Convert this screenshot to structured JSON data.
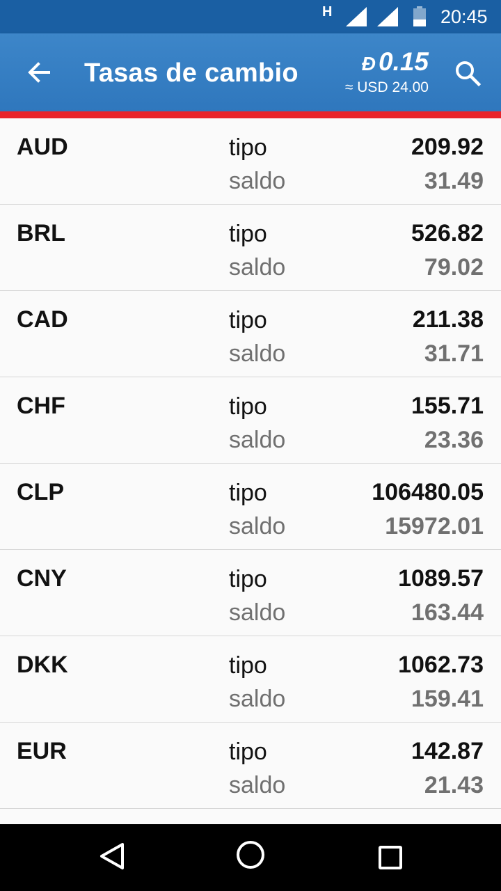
{
  "status_bar": {
    "network_type": "H",
    "time": "20:45",
    "icons": [
      "signal-icon",
      "signal-icon",
      "battery-icon"
    ]
  },
  "app_bar": {
    "title": "Tasas de cambio",
    "balance_symbol": "Đ",
    "balance_value": "0.15",
    "balance_fiat": "≈ USD 24.00",
    "icons": [
      "back-arrow-icon",
      "search-icon"
    ]
  },
  "labels": {
    "rate": "tipo",
    "balance": "saldo"
  },
  "rates": [
    {
      "code": "AUD",
      "rate": "209.92",
      "balance": "31.49"
    },
    {
      "code": "BRL",
      "rate": "526.82",
      "balance": "79.02"
    },
    {
      "code": "CAD",
      "rate": "211.38",
      "balance": "31.71"
    },
    {
      "code": "CHF",
      "rate": "155.71",
      "balance": "23.36"
    },
    {
      "code": "CLP",
      "rate": "106480.05",
      "balance": "15972.01"
    },
    {
      "code": "CNY",
      "rate": "1089.57",
      "balance": "163.44"
    },
    {
      "code": "DKK",
      "rate": "1062.73",
      "balance": "159.41"
    },
    {
      "code": "EUR",
      "rate": "142.87",
      "balance": "21.43"
    }
  ],
  "nav_bar": {
    "icons": [
      "nav-back-icon",
      "nav-home-icon",
      "nav-recents-icon"
    ]
  },
  "colors": {
    "status_bar": "#1a5fa3",
    "app_bar": "#3580c4",
    "accent_line": "#e8232a",
    "secondary_text": "#707070"
  }
}
